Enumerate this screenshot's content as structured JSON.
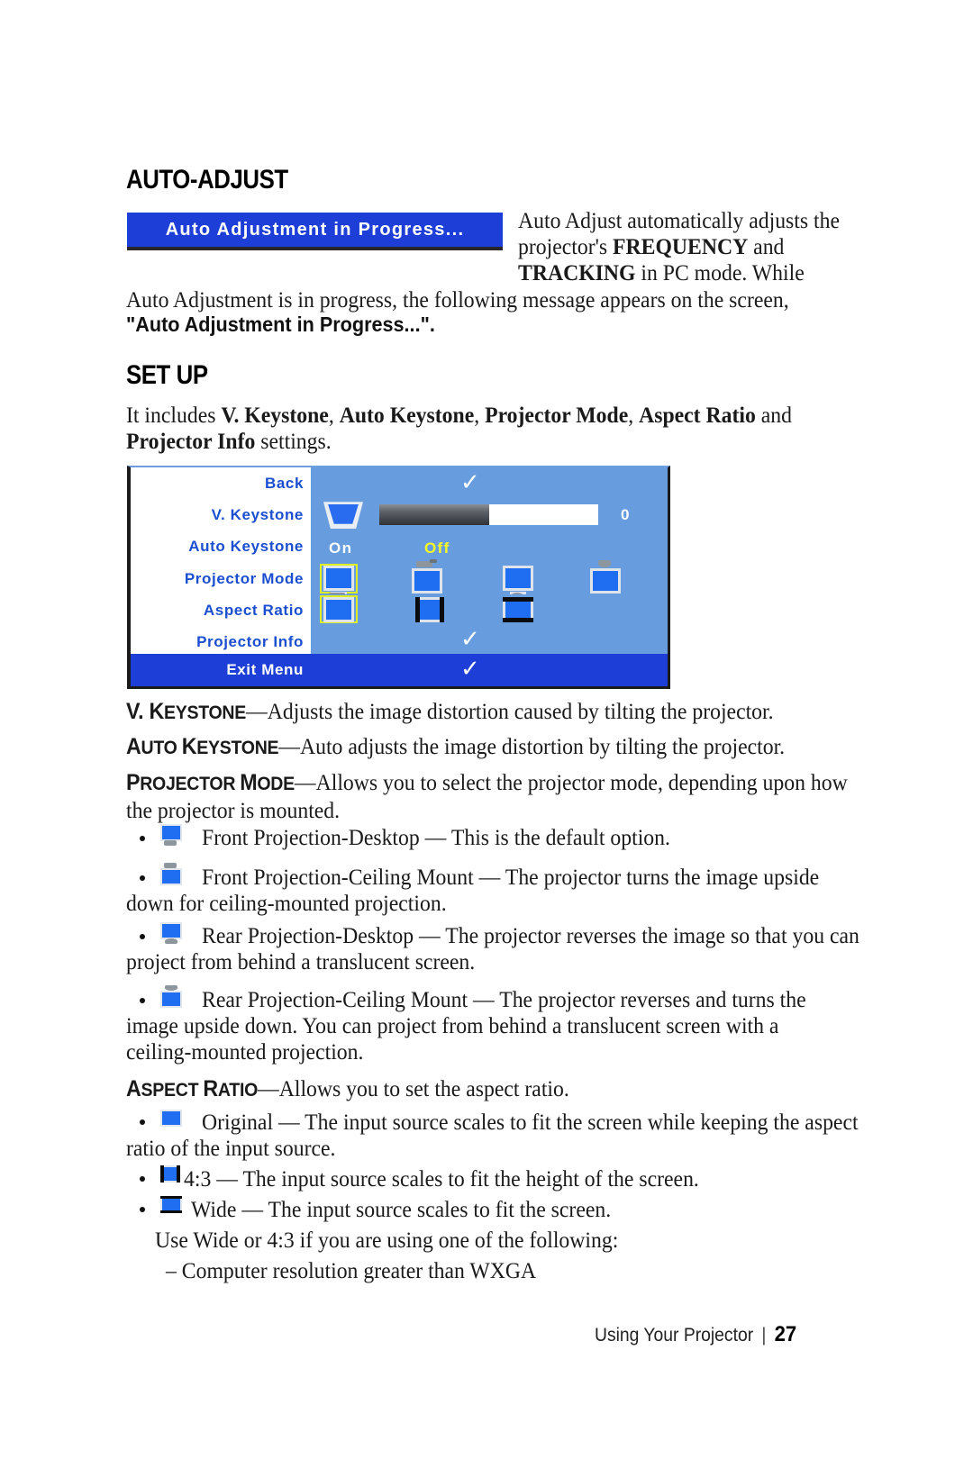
{
  "document": {
    "sections": {
      "auto_adjust": {
        "heading": "AUTO-ADJUST",
        "message_box": "Auto Adjustment in Progress...",
        "para_right_line1": "Auto Adjust automatically adjusts the",
        "para_right_line2_prefix": "projector's ",
        "para_right_line2_bold": "FREQUENCY",
        "para_right_line2_suffix": " and",
        "para_right_line3_bold": "TRACKING",
        "para_right_line3_suffix": " in PC mode. While",
        "para_full_line": "Auto Adjustment is in progress, the following message appears on the screen,",
        "para_quote": "\"Auto Adjustment in Progress...\"."
      },
      "set_up": {
        "heading": "SET UP",
        "intro_prefix": "It includes ",
        "intro_bold_1": "V. Keystone",
        "intro_sep_1": ", ",
        "intro_bold_2": "Auto Keystone",
        "intro_sep_2": ", ",
        "intro_bold_3": "Projector Mode",
        "intro_sep_3": ", ",
        "intro_bold_4": "Aspect Ratio",
        "intro_mid": " and ",
        "intro_bold_5": "Projector Info",
        "intro_suffix": " settings."
      }
    },
    "definitions": [
      {
        "term_cap": "V. K",
        "term_rest": "EYSTONE",
        "dash": "—",
        "text": "Adjusts the image distortion caused by tilting the projector."
      },
      {
        "term_cap": "A",
        "term_rest": "UTO ",
        "term_cap2": "K",
        "term_rest2": "EYSTONE",
        "dash": "—",
        "text": "Auto adjusts the image distortion by tilting the projector."
      },
      {
        "term_cap": "P",
        "term_rest": "ROJECTOR ",
        "term_cap2": "M",
        "term_rest2": "ODE",
        "dash": "—",
        "text": "Allows you to select the projector mode, depending upon how",
        "text_line2": "the projector is mounted."
      },
      {
        "term_cap": "A",
        "term_rest": "SPECT ",
        "term_cap2": "R",
        "term_rest2": "ATIO",
        "dash": "—",
        "text": "Allows you to set the aspect ratio."
      }
    ],
    "projector_mode_bullets": [
      {
        "icon": "front-projection-desktop-icon",
        "line1": "Front Projection-Desktop — This is the default option."
      },
      {
        "icon": "front-projection-ceiling-icon",
        "line1": "Front Projection-Ceiling Mount — The projector turns the image upside",
        "line2": "down for ceiling-mounted projection."
      },
      {
        "icon": "rear-projection-desktop-icon",
        "line1": "Rear Projection-Desktop — The projector reverses the image so that you can",
        "line2": "project from behind a translucent screen."
      },
      {
        "icon": "rear-projection-ceiling-icon",
        "line1": "Rear Projection-Ceiling Mount — The projector reverses and turns the",
        "line2": "image upside down. You can project from behind a translucent screen with a",
        "line3": "ceiling-mounted projection."
      }
    ],
    "aspect_ratio_bullets": [
      {
        "icon": "aspect-original-icon",
        "line1": "Original — The input source scales to fit the screen while keeping the aspect",
        "line2": "ratio of the input source."
      },
      {
        "icon": "aspect-4-3-icon",
        "line1": "4:3 — The input source scales to fit the height of the screen."
      },
      {
        "icon": "aspect-wide-icon",
        "line1": "Wide — The input source scales to fit the screen."
      }
    ],
    "aspect_notes": {
      "use_line": "Use Wide or 4:3 if you are using one of the following:",
      "dash_item": "– Computer resolution greater than WXGA"
    },
    "footer": {
      "title": "Using Your Projector",
      "separator": "|",
      "page": "27"
    }
  },
  "osd_menu": {
    "rows": [
      {
        "label": "Back",
        "control": "check"
      },
      {
        "label": "V. Keystone",
        "control": "slider"
      },
      {
        "label": "Auto Keystone",
        "control": "onoff"
      },
      {
        "label": "Projector Mode",
        "control": "mode-icons"
      },
      {
        "label": "Aspect Ratio",
        "control": "aspect-icons"
      },
      {
        "label": "Projector Info",
        "control": "check"
      }
    ],
    "exit_row": {
      "label": "Exit Menu",
      "control": "check"
    },
    "keystone": {
      "value": "0",
      "fill_percent": 50
    },
    "auto_keystone": {
      "on_label": "On",
      "off_label": "Off",
      "selected": "Off"
    },
    "projector_mode_icons": [
      {
        "name": "front-projection-desktop-icon",
        "selected": true
      },
      {
        "name": "front-projection-ceiling-icon",
        "selected": false
      },
      {
        "name": "rear-projection-desktop-icon",
        "selected": false
      },
      {
        "name": "rear-projection-ceiling-icon",
        "selected": false
      }
    ],
    "aspect_ratio_icons": [
      {
        "name": "aspect-original-icon",
        "selected": true
      },
      {
        "name": "aspect-4-3-icon",
        "selected": false
      },
      {
        "name": "aspect-wide-icon",
        "selected": false
      }
    ],
    "colors": {
      "panel_bg": "#679ddf",
      "label_bg": "#ffffff",
      "label_text": "#1b4fd0",
      "exit_bg": "#1d3fd8",
      "highlight": "#fbf91f",
      "selection_border": "#ddee22"
    }
  }
}
